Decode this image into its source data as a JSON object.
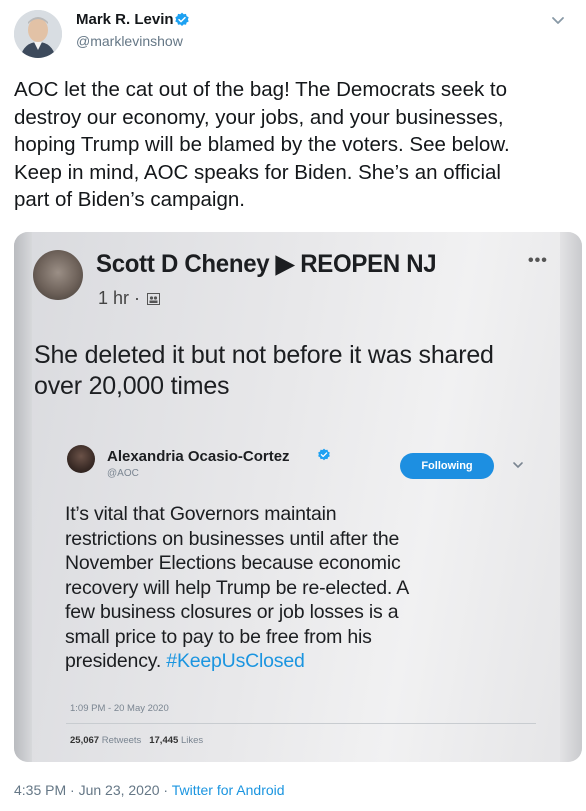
{
  "tweet": {
    "author_name": "Mark R. Levin",
    "author_handle": "@marklevinshow",
    "text_lines": [
      "AOC let the cat out of the bag!  The Democrats seek to",
      "destroy our economy, your jobs, and your businesses,",
      "hoping Trump will be blamed by the voters.  See below.",
      "Keep in mind, AOC speaks for Biden. She’s an official",
      "part of Biden’s campaign."
    ],
    "timestamp": "4:35 PM · Jun 23, 2020 · ",
    "source": "Twitter for Android"
  },
  "photo": {
    "fb_post": {
      "name": "Scott D Cheney ▶ REOPEN NJ",
      "time": "1 hr ·",
      "more": "•••",
      "text_lines": [
        "She deleted it but not before it was shared",
        "over 20,000 times"
      ]
    },
    "embedded_tweet": {
      "name": "Alexandria Ocasio-Cortez",
      "handle": "@AOC",
      "follow_label": "Following",
      "text_lines": [
        "It’s vital that Governors maintain",
        "restrictions on businesses until after the",
        "November Elections because economic",
        "recovery will help Trump be re-elected. A",
        "few business closures or job losses is a",
        "small price to pay to be free from his",
        "presidency. "
      ],
      "hashtag": "#KeepUsClosed",
      "time": "1:09 PM - 20 May 2020",
      "retweets_count": "25,067",
      "retweets_label": "Retweets",
      "likes_count": "17,445",
      "likes_label": "Likes"
    }
  },
  "colors": {
    "link": "#1b95e0",
    "verified": "#1da1f2",
    "secondary_text": "#657786"
  }
}
